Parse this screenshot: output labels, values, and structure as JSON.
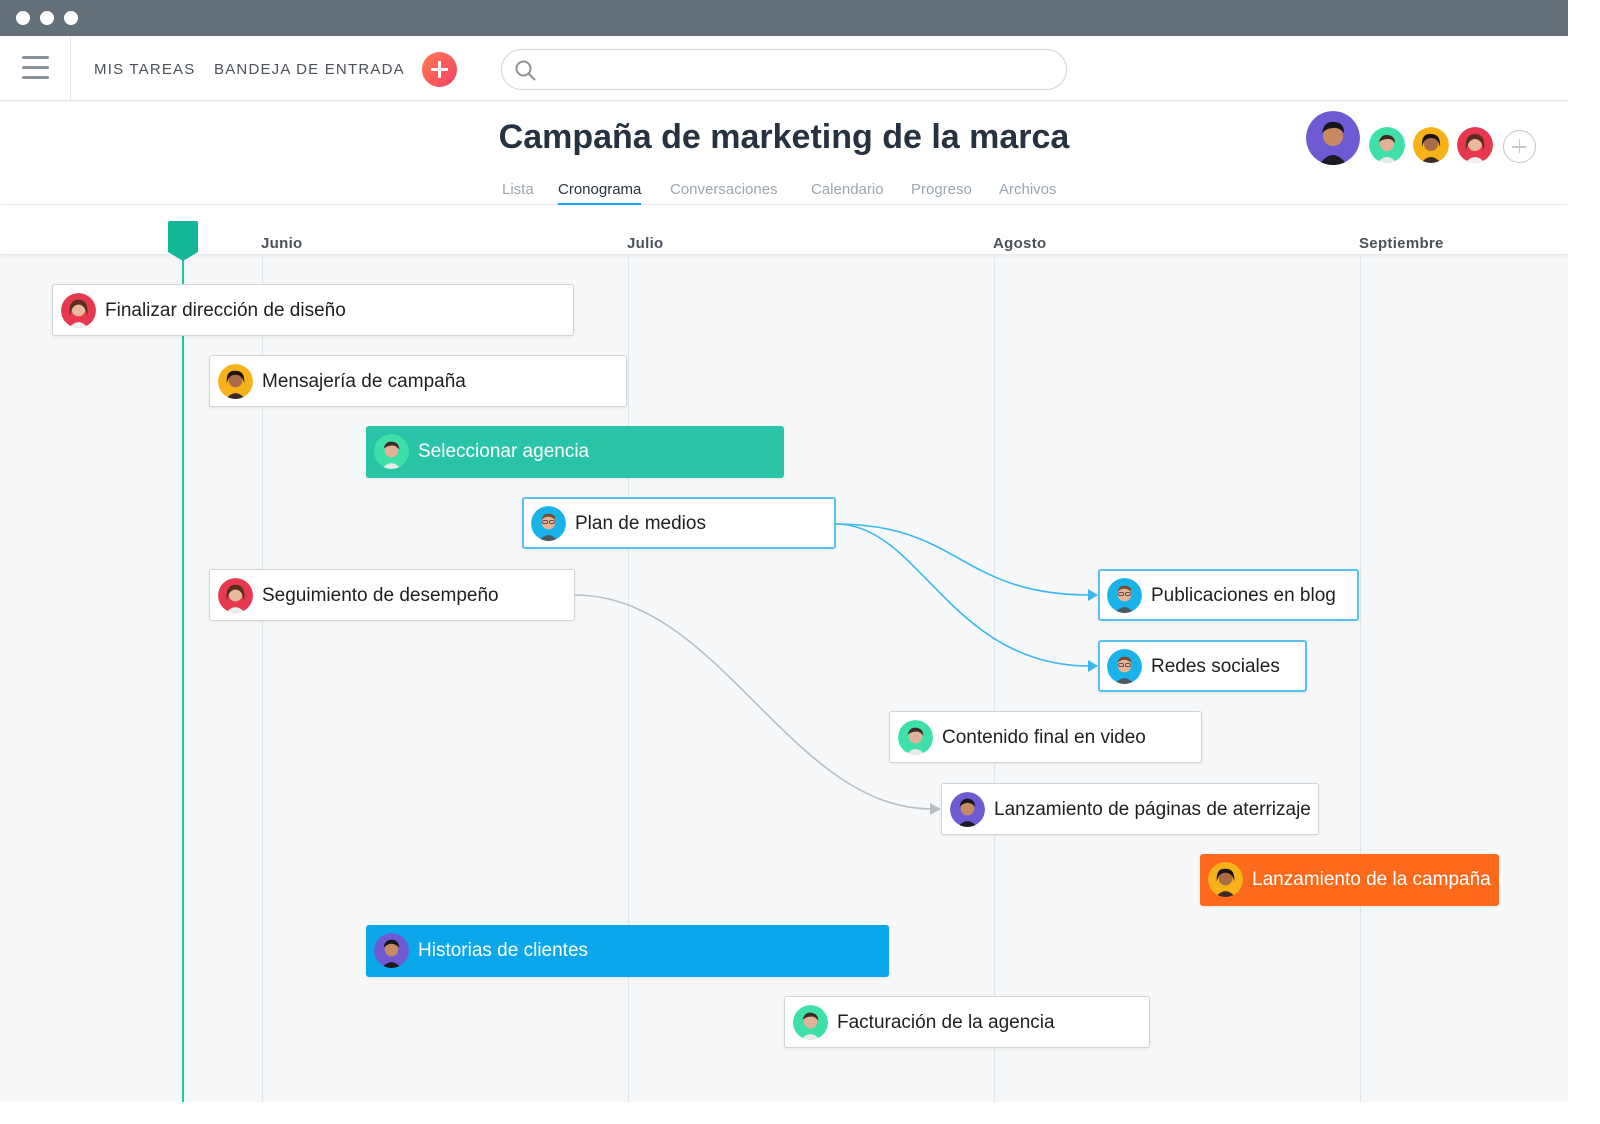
{
  "nav": {
    "my_tasks": "MIS TAREAS",
    "inbox": "BANDEJA DE ENTRADA",
    "search_placeholder": ""
  },
  "project": {
    "title": "Campaña de marketing de la marca",
    "tabs": [
      "Lista",
      "Cronograma",
      "Conversaciones",
      "Calendario",
      "Progreso",
      "Archivos"
    ],
    "active_tab": "Cronograma"
  },
  "timeline": {
    "months": [
      "Junio",
      "Julio",
      "Agosto",
      "Septiembre"
    ]
  },
  "tasks": [
    {
      "name": "Finalizar dirección de diseño",
      "style": "outline"
    },
    {
      "name": "Mensajería de campaña",
      "style": "outline"
    },
    {
      "name": "Seleccionar agencia",
      "style": "filled",
      "color": "#2ac5a8"
    },
    {
      "name": "Plan de medios",
      "style": "selected"
    },
    {
      "name": "Seguimiento de desempeño",
      "style": "outline"
    },
    {
      "name": "Publicaciones en blog",
      "style": "selected"
    },
    {
      "name": "Redes sociales",
      "style": "selected"
    },
    {
      "name": "Contenido final en video",
      "style": "outline"
    },
    {
      "name": "Lanzamiento de páginas de aterrizaje",
      "style": "outline"
    },
    {
      "name": "Lanzamiento de la campaña",
      "style": "filled",
      "color": "#fd6a1b"
    },
    {
      "name": "Historias de clientes",
      "style": "filled",
      "color": "#0aa8ea"
    },
    {
      "name": "Facturación de la agencia",
      "style": "outline"
    }
  ],
  "colors": {
    "accent_blue": "#14aaf5",
    "teal": "#25c4a3",
    "dependency_selected": "#3cb8ef",
    "dependency": "#b9bfc4"
  }
}
